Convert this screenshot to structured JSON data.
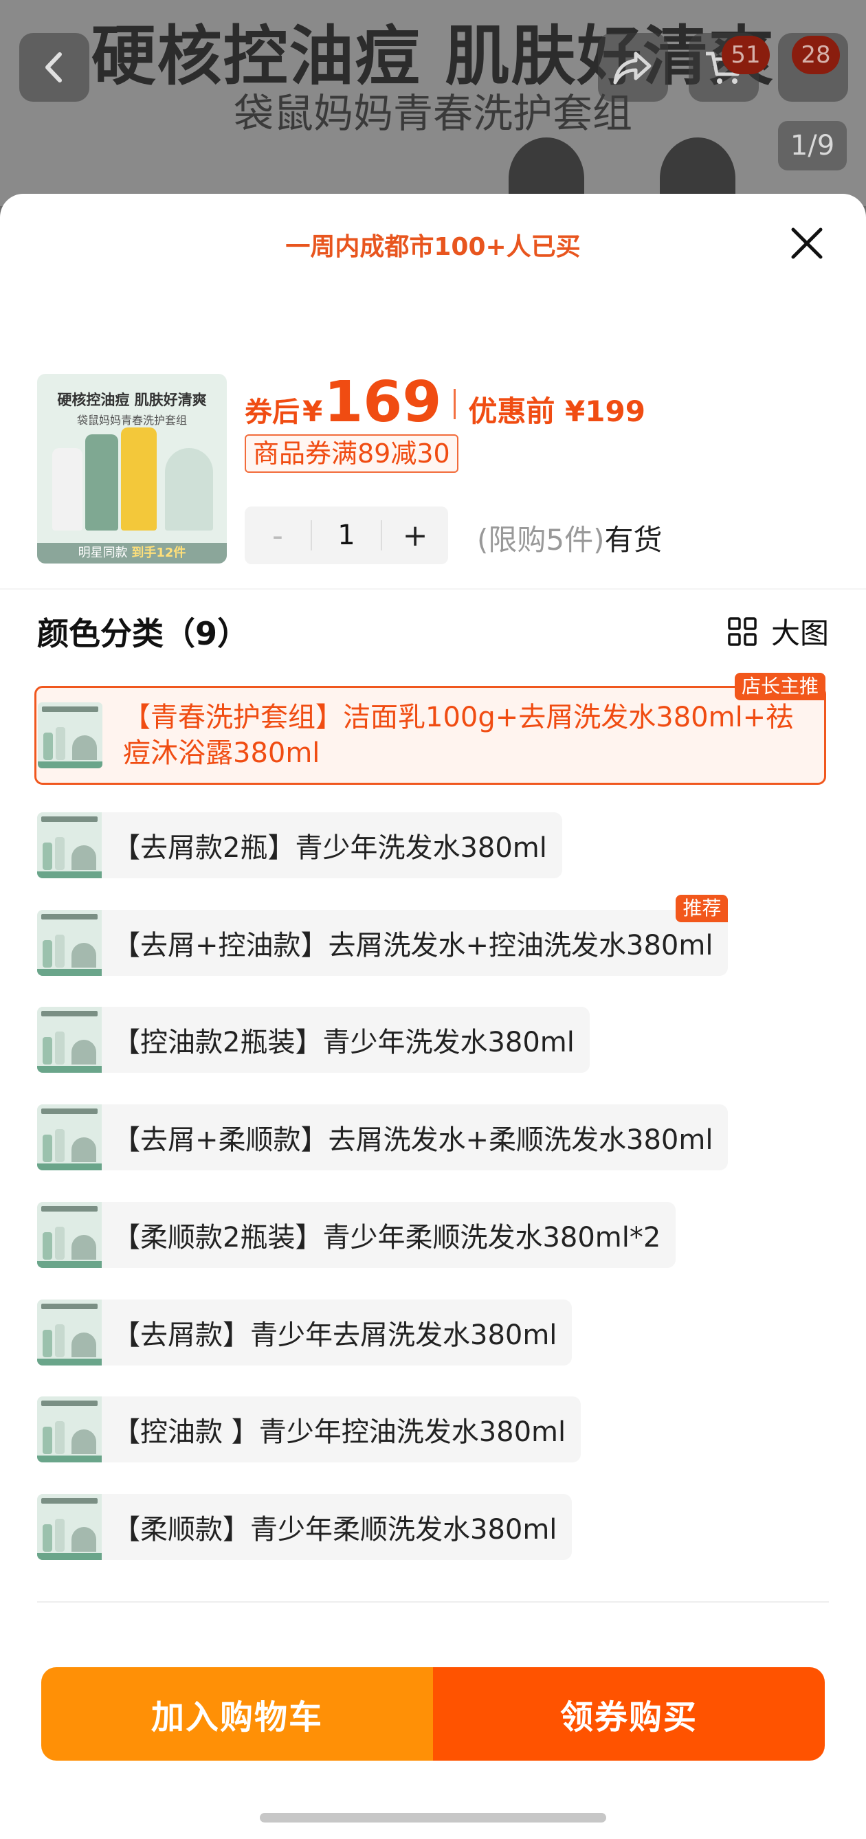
{
  "background": {
    "title": "硬核控油痘 肌肤好清爽",
    "subtitle": "袋鼠妈妈青春洗护套组",
    "cart_badge": "51",
    "more_badge": "28",
    "image_counter": "1/9"
  },
  "sheet": {
    "social_proof": "一周内成都市100+人已买",
    "product_thumb": {
      "headline": "硬核控油痘 肌肤好清爽",
      "subline": "袋鼠妈妈青春洗护套组",
      "footer_prefix": "明星同款",
      "footer_highlight": "到手12件"
    },
    "price": {
      "after_label": "券后",
      "currency": "¥",
      "after_value": "169",
      "before_label": "优惠前 ¥199"
    },
    "coupon": "商品券满89减30",
    "quantity": {
      "minus": "-",
      "value": "1",
      "plus": "+"
    },
    "stock": {
      "limit": "(限购5件)",
      "status": "有货"
    },
    "section": {
      "title": "颜色分类（9）",
      "big_view": "大图"
    },
    "options": [
      {
        "label": "【青春洗护套组】洁面乳100g+去屑洗发水380ml+祛痘沐浴露380ml",
        "tag": "店长主推"
      },
      {
        "label": "【去屑款2瓶】青少年洗发水380ml"
      },
      {
        "label": "【去屑+控油款】去屑洗发水+控油洗发水380ml",
        "tag": "推荐"
      },
      {
        "label": "【控油款2瓶装】青少年洗发水380ml"
      },
      {
        "label": "【去屑+柔顺款】去屑洗发水+柔顺洗发水380ml"
      },
      {
        "label": "【柔顺款2瓶装】青少年柔顺洗发水380ml*2"
      },
      {
        "label": "【去屑款】青少年去屑洗发水380ml"
      },
      {
        "label": "【控油款 】青少年控油洗发水380ml"
      },
      {
        "label": "【柔顺款】青少年柔顺洗发水380ml"
      }
    ],
    "actions": {
      "add_to_cart": "加入购物车",
      "buy": "领券购买"
    }
  },
  "colors": {
    "accent": "#f04c12",
    "cart_button": "#ff9006",
    "buy_button": "#ff5300"
  }
}
